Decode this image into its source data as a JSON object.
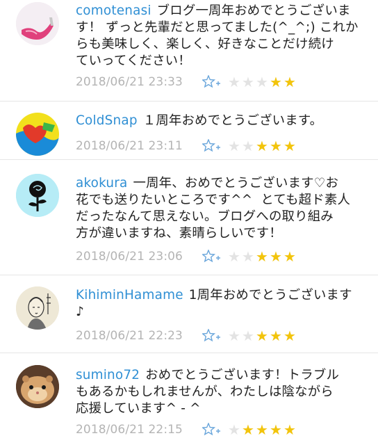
{
  "comments": [
    {
      "user": "comotenasi",
      "text": "ブログ一周年おめでとうございま\nす！ ずっと先輩だと思ってました(^_^;) これか\nらも美味しく、楽しく、好きなことだけ続け\nていってください！",
      "date": "2018/06/21 23:33",
      "rating": 2,
      "max_rating": 5,
      "avatar_icon": "high-heel-shoe-avatar-icon"
    },
    {
      "user": "ColdSnap",
      "text": "１周年おめでとうございます。",
      "date": "2018/06/21 23:11",
      "rating": 3,
      "max_rating": 5,
      "avatar_icon": "colorful-heart-avatar-icon"
    },
    {
      "user": "akokura",
      "text": "一周年、おめでとうございます♡お\n花でも送りたいところです^^  とても超ド素人\nだったなんて思えない。ブログへの取り組み\n方が違いますね、素晴らしいです！",
      "date": "2018/06/21 23:06",
      "rating": 3,
      "max_rating": 5,
      "avatar_icon": "rose-avatar-icon"
    },
    {
      "user": "KihiminHamame",
      "text": "1周年おめでとうございます\n♪",
      "date": "2018/06/21 22:23",
      "rating": 3,
      "max_rating": 5,
      "avatar_icon": "ukiyoe-portrait-avatar-icon"
    },
    {
      "user": "sumino72",
      "text": "おめでとうございます！トラブル\nもあるかもしれませんが、わたしは陰ながら\n応援しています^ - ^",
      "date": "2018/06/21 22:15",
      "rating": 4,
      "max_rating": 5,
      "avatar_icon": "hamster-avatar-icon"
    }
  ],
  "colors": {
    "username": "#2f8fd4",
    "text": "#222222",
    "date": "#b4b4b4",
    "star_on": "#f2c40c",
    "star_off": "#e3e3e3",
    "divider": "#e6e6e6"
  }
}
